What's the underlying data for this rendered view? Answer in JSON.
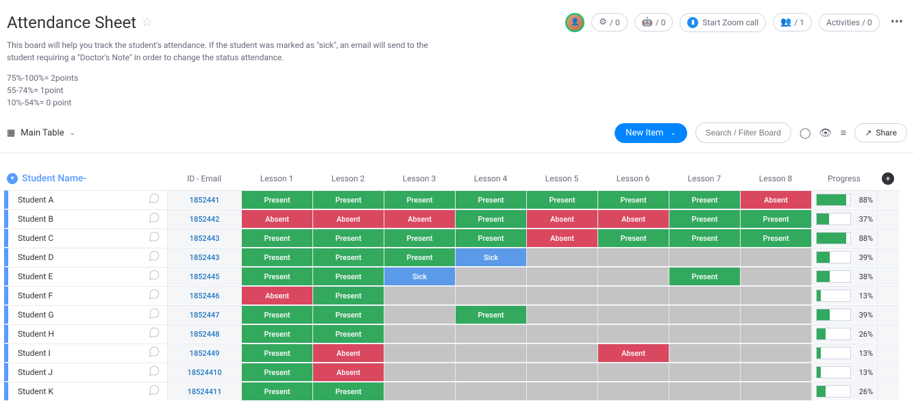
{
  "header": {
    "title": "Attendance Sheet",
    "description": "This board will help you track the student's attendance. If the student was marked as \"sick\", an email will send to the student requiring a \"Doctor's Note\" in order to change the status attendance.",
    "points": [
      "75%-100%= 2points",
      "55-74%= 1point",
      "10%-54%= 0 point"
    ],
    "buttons": {
      "integration_count": "/ 0",
      "automation_count": "/ 0",
      "zoom_label": "Start Zoom call",
      "members_count": "/ 1",
      "activities_label": "Activities / 0"
    }
  },
  "toolbar": {
    "main_table": "Main Table",
    "new_item": "New Item",
    "search_placeholder": "Search / Filter Board",
    "share": "Share"
  },
  "table": {
    "group_name": "Student Name-",
    "columns": {
      "id": "ID - Email",
      "lessons": [
        "Lesson 1",
        "Lesson 2",
        "Lesson 3",
        "Lesson 4",
        "Lesson 5",
        "Lesson 6",
        "Lesson 7",
        "Lesson 8"
      ],
      "progress": "Progress"
    },
    "status_labels": {
      "present": "Present",
      "absent": "Absent",
      "sick": "Sick",
      "empty": ""
    },
    "rows": [
      {
        "name": "Student A",
        "id": "1852441",
        "lessons": [
          "present",
          "present",
          "present",
          "present",
          "present",
          "present",
          "present",
          "absent"
        ],
        "progress": 88
      },
      {
        "name": "Student B",
        "id": "1852442",
        "lessons": [
          "absent",
          "absent",
          "absent",
          "present",
          "absent",
          "absent",
          "present",
          "present"
        ],
        "progress": 37
      },
      {
        "name": "Student C",
        "id": "1852443",
        "lessons": [
          "present",
          "present",
          "present",
          "present",
          "absent",
          "present",
          "present",
          "present"
        ],
        "progress": 88
      },
      {
        "name": "Student D",
        "id": "1852443",
        "lessons": [
          "present",
          "present",
          "present",
          "sick",
          "empty",
          "empty",
          "empty",
          "empty"
        ],
        "progress": 39
      },
      {
        "name": "Student E",
        "id": "1852445",
        "lessons": [
          "present",
          "present",
          "sick",
          "empty",
          "empty",
          "empty",
          "present",
          "empty"
        ],
        "progress": 38
      },
      {
        "name": "Student F",
        "id": "1852446",
        "lessons": [
          "absent",
          "present",
          "empty",
          "empty",
          "empty",
          "empty",
          "empty",
          "empty"
        ],
        "progress": 13
      },
      {
        "name": "Student G",
        "id": "1852447",
        "lessons": [
          "present",
          "present",
          "empty",
          "present",
          "empty",
          "empty",
          "empty",
          "empty"
        ],
        "progress": 39
      },
      {
        "name": "Student H",
        "id": "1852448",
        "lessons": [
          "present",
          "present",
          "empty",
          "empty",
          "empty",
          "empty",
          "empty",
          "empty"
        ],
        "progress": 26
      },
      {
        "name": "Student I",
        "id": "1852449",
        "lessons": [
          "present",
          "absent",
          "empty",
          "empty",
          "empty",
          "absent",
          "empty",
          "empty"
        ],
        "progress": 13
      },
      {
        "name": "Student J",
        "id": "18524410",
        "lessons": [
          "present",
          "absent",
          "empty",
          "empty",
          "empty",
          "empty",
          "empty",
          "empty"
        ],
        "progress": 13
      },
      {
        "name": "Student K",
        "id": "18524411",
        "lessons": [
          "present",
          "present",
          "empty",
          "empty",
          "empty",
          "empty",
          "empty",
          "empty"
        ],
        "progress": 26
      }
    ]
  }
}
